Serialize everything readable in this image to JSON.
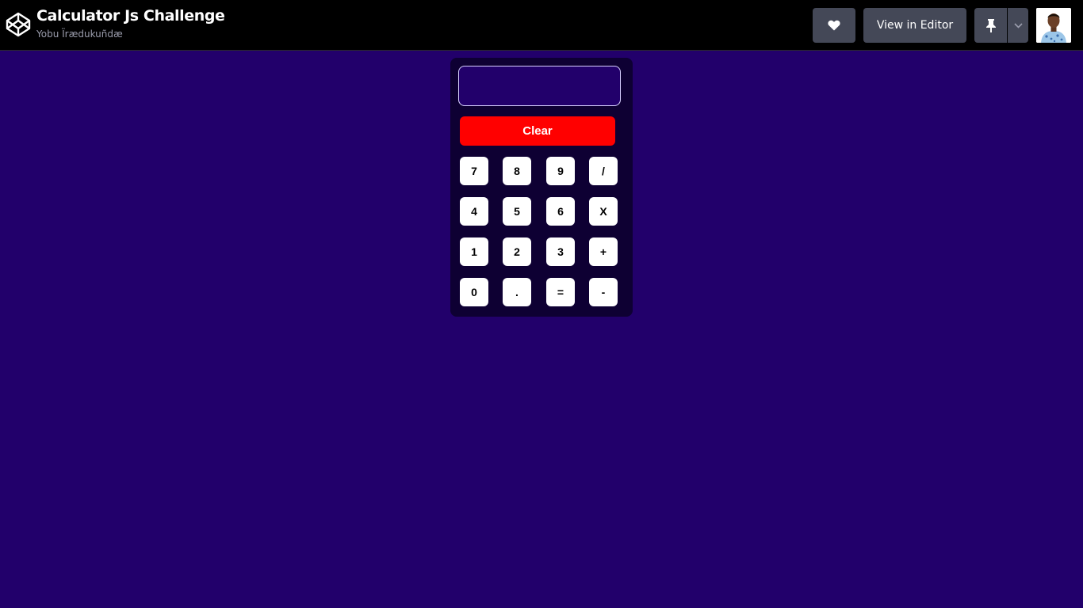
{
  "header": {
    "title": "Calculator Js Challenge",
    "author": "Yobu Ïrædukuñdæ",
    "heart_icon": "heart-icon",
    "view_in_editor": "View in Editor",
    "pin_icon": "pin-icon",
    "chevron_icon": "chevron-down-icon",
    "logo_icon": "codepen-logo-icon"
  },
  "colors": {
    "page_background": "#22006b",
    "calculator_background": "#0e0033",
    "clear_button": "#ff0000",
    "header_button": "#444857"
  },
  "calculator": {
    "display_value": "",
    "clear_label": "Clear",
    "keys": [
      [
        "7",
        "8",
        "9",
        "/"
      ],
      [
        "4",
        "5",
        "6",
        "X"
      ],
      [
        "1",
        "2",
        "3",
        "+"
      ],
      [
        "0",
        ".",
        "=",
        "-"
      ]
    ]
  }
}
